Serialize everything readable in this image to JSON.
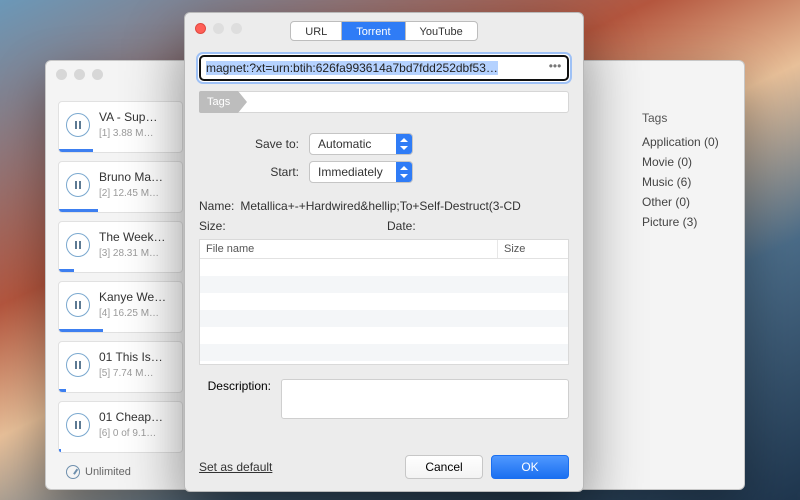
{
  "back": {
    "downloads": [
      {
        "title": "VA - Sup…",
        "sub": "[1]  3.88 M…",
        "progress": 28
      },
      {
        "title": "Bruno Ma…",
        "sub": "[2]  12.45 M…",
        "progress": 32
      },
      {
        "title": "The Week…",
        "sub": "[3]  28.31 M…",
        "progress": 12
      },
      {
        "title": "Kanye We…",
        "sub": "[4]  16.25 M…",
        "progress": 36
      },
      {
        "title": "01 This Is…",
        "sub": "[5]  7.74 M…",
        "progress": 6
      },
      {
        "title": "01 Cheap…",
        "sub": "[6]  0 of 9.1…",
        "progress": 2
      }
    ],
    "tags_header": "Tags",
    "tags": [
      "Application (0)",
      "Movie (0)",
      "Music (6)",
      "Other (0)",
      "Picture (3)"
    ],
    "speed_label": "Unlimited"
  },
  "dialog": {
    "tabs": {
      "url": "URL",
      "torrent": "Torrent",
      "youtube": "YouTube"
    },
    "magnet": "magnet:?xt=urn:btih:626fa993614a7bd7fdd252dbf53…",
    "tags_chip": "Tags",
    "save_to_label": "Save to:",
    "save_to_value": "Automatic",
    "start_label": "Start:",
    "start_value": "Immediately",
    "name_label": "Name:",
    "name_value": "Metallica+-+Hardwired&hellip;To+Self-Destruct(3-CD",
    "size_label": "Size:",
    "date_label": "Date:",
    "col_file": "File name",
    "col_size": "Size",
    "desc_label": "Description:",
    "set_default": "Set as default",
    "cancel": "Cancel",
    "ok": "OK"
  }
}
